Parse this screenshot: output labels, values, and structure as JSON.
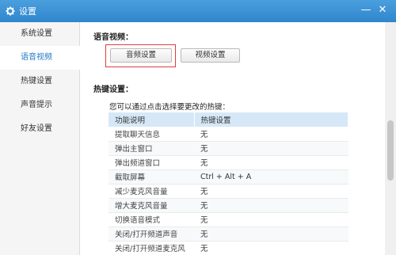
{
  "window": {
    "title": "设置",
    "minimize_glyph": "—",
    "close_glyph": "✕",
    "accent_color": "#2f86cc"
  },
  "sidebar": {
    "items": [
      {
        "label": "系统设置",
        "active": false
      },
      {
        "label": "语音视频",
        "active": true
      },
      {
        "label": "热键设置",
        "active": false
      },
      {
        "label": "声音提示",
        "active": false
      },
      {
        "label": "好友设置",
        "active": false
      }
    ]
  },
  "voice": {
    "heading": "语音视频：",
    "audio_button": "音频设置",
    "video_button": "视频设置"
  },
  "hotkeys": {
    "heading": "热键设置：",
    "hint": "您可以通过点击选择要更改的热键：",
    "columns": [
      "功能说明",
      "热键设置"
    ],
    "rows": [
      [
        "提取聊天信息",
        "无"
      ],
      [
        "弹出主窗口",
        "无"
      ],
      [
        "弹出频道窗口",
        "无"
      ],
      [
        "截取屏幕",
        "Ctrl + Alt + A"
      ],
      [
        "减少麦克风音量",
        "无"
      ],
      [
        "增大麦克风音量",
        "无"
      ],
      [
        "切换语音模式",
        "无"
      ],
      [
        "关闭/打开频道声音",
        "无"
      ],
      [
        "关闭/打开频道麦克风",
        "无"
      ]
    ]
  }
}
